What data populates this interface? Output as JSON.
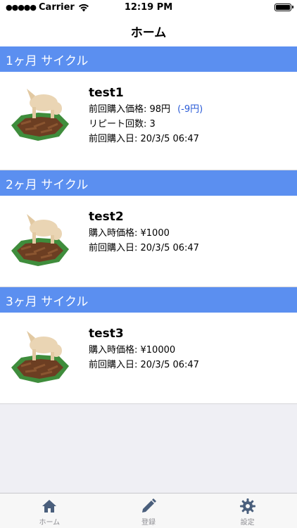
{
  "status_bar": {
    "carrier": "Carrier",
    "time": "12:19 PM"
  },
  "nav": {
    "title": "ホーム"
  },
  "sections": [
    {
      "header": "1ヶ月 サイクル",
      "item": {
        "name": "test1",
        "line1_label": "前回購入価格: ",
        "line1_value": "98円",
        "line1_diff": "(-9円)",
        "line2": "リピート回数: 3",
        "line3": "前回購入日: 20/3/5 06:47"
      }
    },
    {
      "header": "2ヶ月 サイクル",
      "item": {
        "name": "test2",
        "line1": "購入時価格: ¥1000",
        "line2": "前回購入日: 20/3/5 06:47"
      }
    },
    {
      "header": "3ヶ月 サイクル",
      "item": {
        "name": "test3",
        "line1": "購入時価格: ¥10000",
        "line2": "前回購入日: 20/3/5 06:47"
      }
    }
  ],
  "tabs": [
    {
      "label": "ホーム",
      "icon": "home-icon"
    },
    {
      "label": "登録",
      "icon": "pencil-icon"
    },
    {
      "label": "設定",
      "icon": "gear-icon"
    }
  ],
  "colors": {
    "section_header": "#5b8ff0",
    "price_diff": "#2a5bd7",
    "tab_icon": "#4a5f7c"
  }
}
